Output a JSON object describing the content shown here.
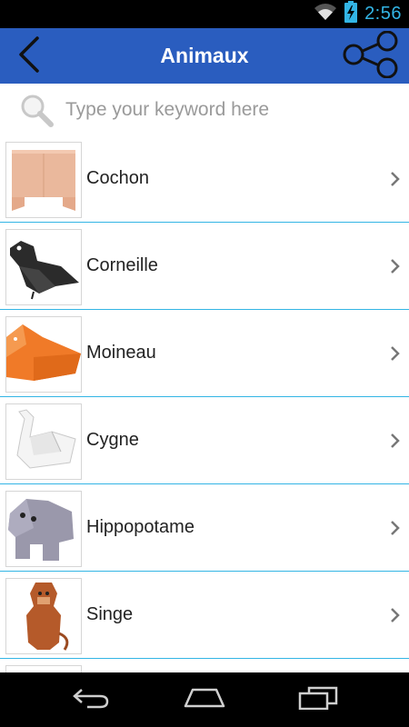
{
  "status_bar": {
    "time": "2:56",
    "wifi_icon": "wifi-icon",
    "battery_icon": "battery-charging-icon",
    "accent": "#33b5e5"
  },
  "app_bar": {
    "title": "Animaux",
    "back_icon": "chevron-left-icon",
    "share_icon": "share-icon",
    "background": "#2a5dbf"
  },
  "search": {
    "placeholder": "Type your keyword here",
    "value": "",
    "icon": "search-icon"
  },
  "list": {
    "items": [
      {
        "label": "Cochon",
        "thumbnail": "origami-cochon"
      },
      {
        "label": "Corneille",
        "thumbnail": "origami-corneille"
      },
      {
        "label": "Moineau",
        "thumbnail": "origami-moineau"
      },
      {
        "label": "Cygne",
        "thumbnail": "origami-cygne"
      },
      {
        "label": "Hippopotame",
        "thumbnail": "origami-hippopotame"
      },
      {
        "label": "Singe",
        "thumbnail": "origami-singe"
      }
    ],
    "divider_color": "#33b5e5"
  },
  "nav_bar": {
    "back": "nav-back-icon",
    "home": "nav-home-icon",
    "recents": "nav-recents-icon"
  }
}
